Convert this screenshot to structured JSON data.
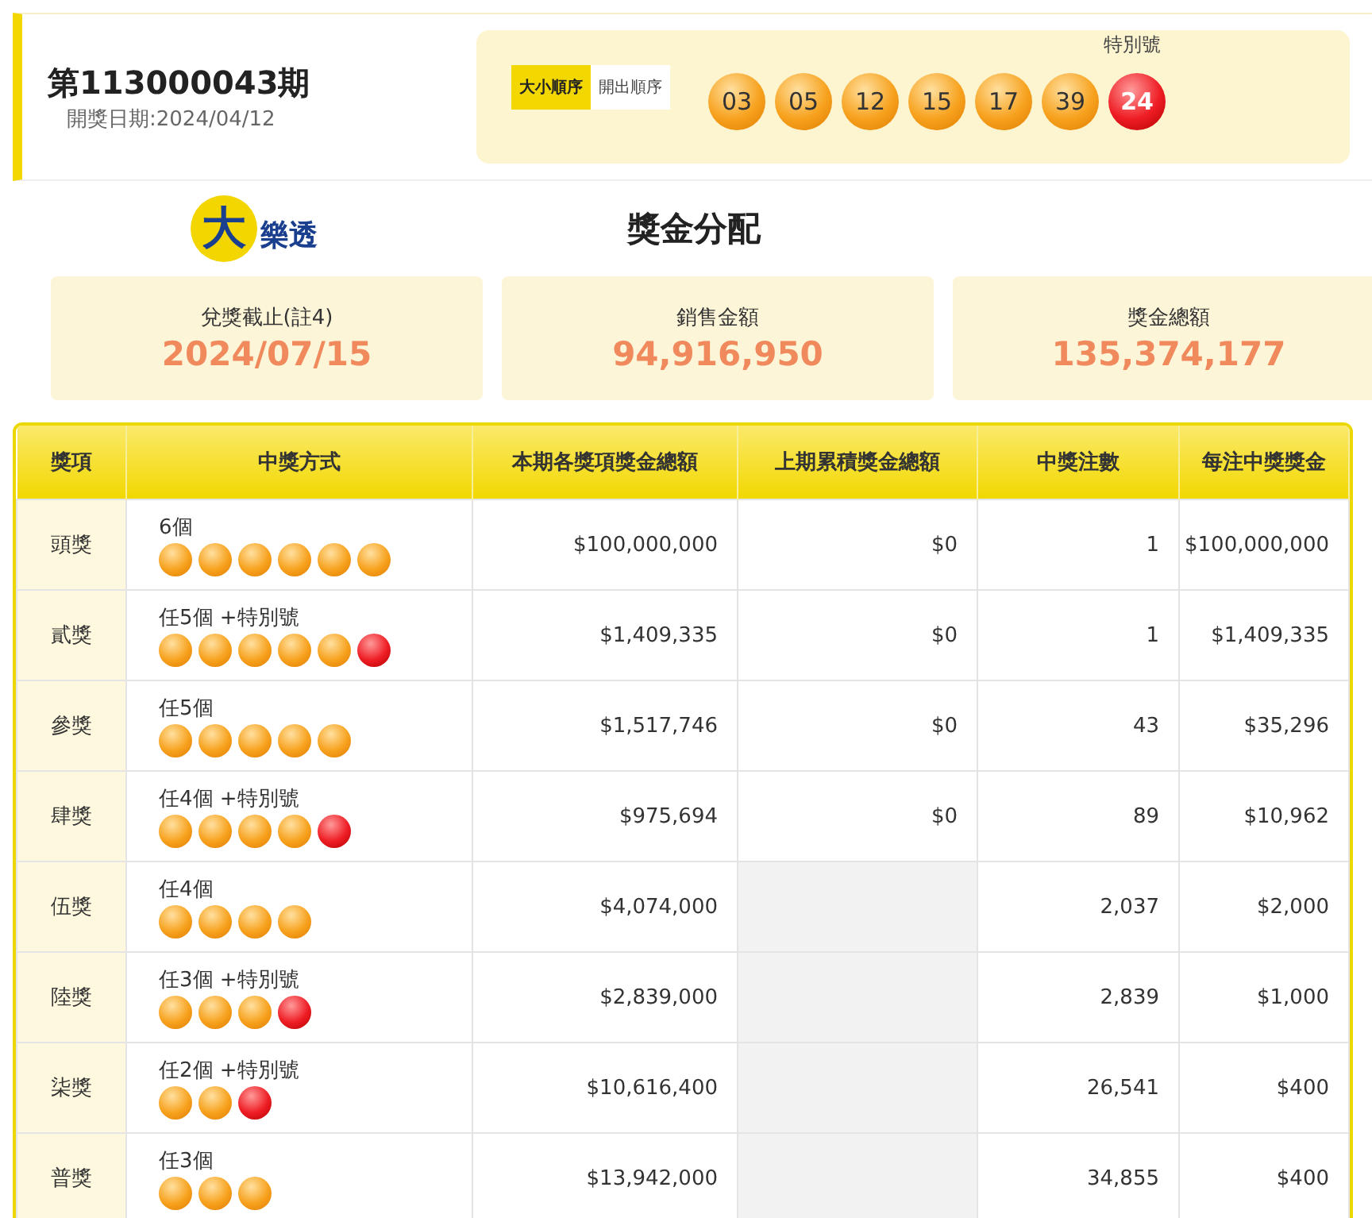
{
  "draw": {
    "issue": "第113000043期",
    "date": "開獎日期:2024/04/12",
    "order_tabs": [
      {
        "label": "大小順序",
        "selected": true
      },
      {
        "label": "開出順序",
        "selected": false
      }
    ],
    "special_label": "特別號",
    "numbers": [
      {
        "value": "03",
        "kind": "regular"
      },
      {
        "value": "05",
        "kind": "regular"
      },
      {
        "value": "12",
        "kind": "regular"
      },
      {
        "value": "15",
        "kind": "regular"
      },
      {
        "value": "17",
        "kind": "regular"
      },
      {
        "value": "39",
        "kind": "regular"
      },
      {
        "value": "24",
        "kind": "special"
      }
    ]
  },
  "logo": {
    "mark": "大",
    "text": "樂透"
  },
  "section_title": "獎金分配",
  "stats": [
    {
      "label": "兌獎截止(註4)",
      "value": "2024/07/15"
    },
    {
      "label": "銷售金額",
      "value": "94,916,950"
    },
    {
      "label": "獎金總額",
      "value": "135,374,177"
    }
  ],
  "table": {
    "columns": [
      "獎項",
      "中獎方式",
      "本期各獎項獎金總額",
      "上期累積獎金總額",
      "中獎注數",
      "每注中獎獎金"
    ],
    "rows": [
      {
        "prize": "頭獎",
        "method": "6個",
        "balls": [
          {
            "kind": "regular"
          },
          {
            "kind": "regular"
          },
          {
            "kind": "regular"
          },
          {
            "kind": "regular"
          },
          {
            "kind": "regular"
          },
          {
            "kind": "regular"
          }
        ],
        "total": "$100,000,000",
        "carryover": "$0",
        "winners": "1",
        "per_ticket": "$100,000,000"
      },
      {
        "prize": "貳獎",
        "method": "任5個 +特別號",
        "balls": [
          {
            "kind": "regular"
          },
          {
            "kind": "regular"
          },
          {
            "kind": "regular"
          },
          {
            "kind": "regular"
          },
          {
            "kind": "regular"
          },
          {
            "kind": "special"
          }
        ],
        "total": "$1,409,335",
        "carryover": "$0",
        "winners": "1",
        "per_ticket": "$1,409,335"
      },
      {
        "prize": "參獎",
        "method": "任5個",
        "balls": [
          {
            "kind": "regular"
          },
          {
            "kind": "regular"
          },
          {
            "kind": "regular"
          },
          {
            "kind": "regular"
          },
          {
            "kind": "regular"
          }
        ],
        "total": "$1,517,746",
        "carryover": "$0",
        "winners": "43",
        "per_ticket": "$35,296"
      },
      {
        "prize": "肆獎",
        "method": "任4個 +特別號",
        "balls": [
          {
            "kind": "regular"
          },
          {
            "kind": "regular"
          },
          {
            "kind": "regular"
          },
          {
            "kind": "regular"
          },
          {
            "kind": "special"
          }
        ],
        "total": "$975,694",
        "carryover": "$0",
        "winners": "89",
        "per_ticket": "$10,962"
      },
      {
        "prize": "伍獎",
        "method": "任4個",
        "balls": [
          {
            "kind": "regular"
          },
          {
            "kind": "regular"
          },
          {
            "kind": "regular"
          },
          {
            "kind": "regular"
          }
        ],
        "total": "$4,074,000",
        "winners": "2,037",
        "per_ticket": "$2,000"
      },
      {
        "prize": "陸獎",
        "method": "任3個 +特別號",
        "balls": [
          {
            "kind": "regular"
          },
          {
            "kind": "regular"
          },
          {
            "kind": "regular"
          },
          {
            "kind": "special"
          }
        ],
        "total": "$2,839,000",
        "winners": "2,839",
        "per_ticket": "$1,000"
      },
      {
        "prize": "柒獎",
        "method": "任2個 +特別號",
        "balls": [
          {
            "kind": "regular"
          },
          {
            "kind": "regular"
          },
          {
            "kind": "special"
          }
        ],
        "total": "$10,616,400",
        "winners": "26,541",
        "per_ticket": "$400"
      },
      {
        "prize": "普獎",
        "method": "任3個",
        "balls": [
          {
            "kind": "regular"
          },
          {
            "kind": "regular"
          },
          {
            "kind": "regular"
          }
        ],
        "total": "$13,942,000",
        "winners": "34,855",
        "per_ticket": "$400"
      }
    ]
  }
}
